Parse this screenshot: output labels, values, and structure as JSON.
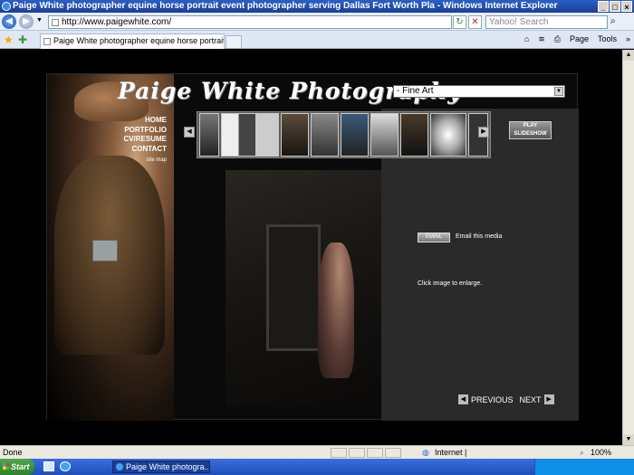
{
  "window": {
    "title": "Paige White photographer equine horse portrait event photographer serving Dallas Fort Worth Pla - Windows Internet Explorer",
    "controls": [
      "_",
      "□",
      "×"
    ]
  },
  "navbar": {
    "address": "http://www.paigewhite.com/",
    "search_placeholder": "Yahoo! Search"
  },
  "tabbar": {
    "tab_title": "Paige White photographer equine horse portrait even...",
    "tools": {
      "page": "Page",
      "tools": "Tools"
    }
  },
  "site": {
    "logo": "Paige White Photography",
    "menu": [
      "HOME",
      "PORTFOLIO",
      "CV/RESUME",
      "CONTACT"
    ],
    "sitemap": "site map",
    "gallery_select": "- Fine Art",
    "slideshow_label": "PLAY SLIDESHOW",
    "email_button": "EMAIL",
    "email_text": "Email this media",
    "enlarge_text": "Click image to enlarge.",
    "previous": "PREVIOUS",
    "next": "NEXT"
  },
  "status": {
    "text": "Done",
    "zone": "Internet |",
    "zoom": "100%"
  },
  "taskbar": {
    "start": "Start",
    "task": "Paige White photogra..."
  }
}
